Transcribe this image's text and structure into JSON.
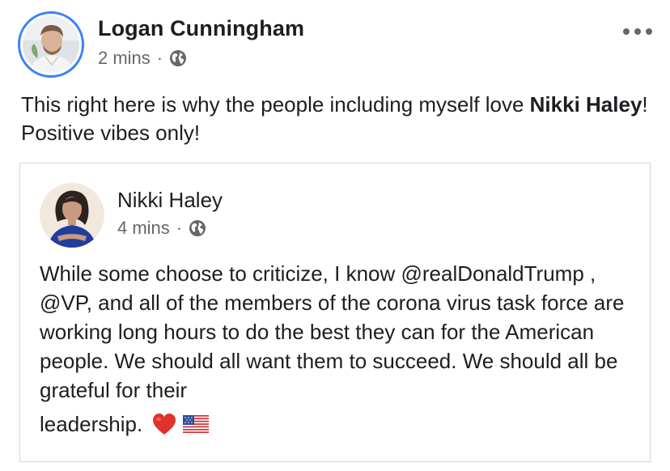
{
  "post": {
    "author": "Logan Cunningham",
    "time": "2 mins",
    "separator": "·",
    "audience_icon": "globe-icon",
    "more_icon": "more-options-icon",
    "text_before": "This right here is why the people including myself love ",
    "text_bold": "Nikki Haley",
    "text_after": "! Positive vibes only!"
  },
  "shared_post": {
    "author": "Nikki Haley",
    "time": "4 mins",
    "separator": "·",
    "audience_icon": "globe-icon",
    "text": "While some choose to criticize, I know @realDonaldTrump , @VP, and all of the members of the corona virus task force are working long hours to do the best they can for the American people. We should all want them to succeed. We should all be grateful for their",
    "last_word": "leadership.",
    "emojis": [
      "red-heart-icon",
      "us-flag-icon"
    ]
  },
  "colors": {
    "text_primary": "#1c1e21",
    "text_secondary": "#65676b",
    "avatar_ring": "#3b82f6",
    "card_border": "#d4d6da"
  }
}
